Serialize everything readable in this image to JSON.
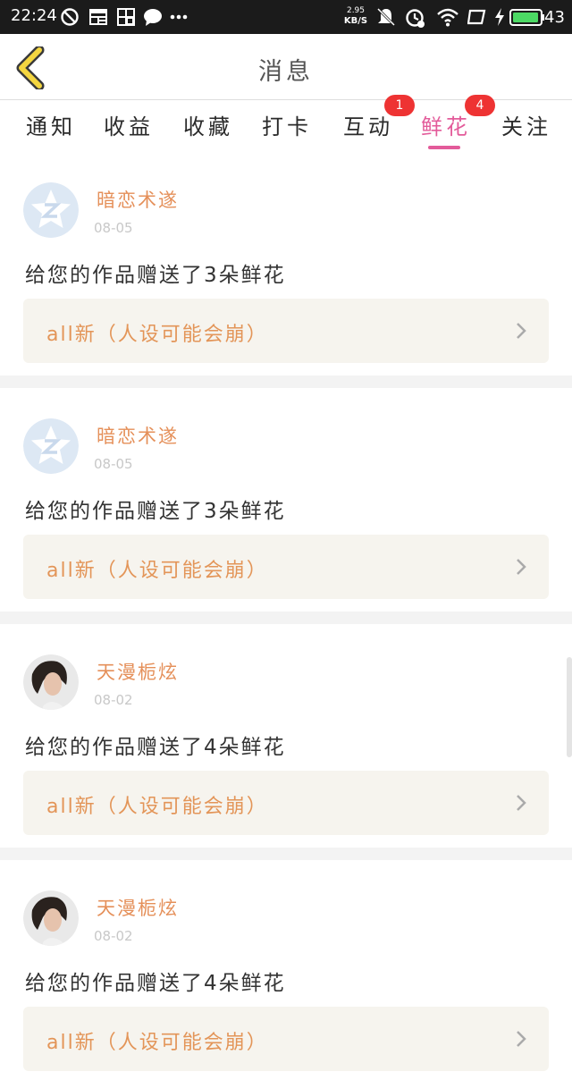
{
  "status_bar": {
    "time": "22:24",
    "net_speed_value": "2.95",
    "net_speed_unit": "KB/S",
    "battery": "43",
    "icons": [
      "do-not-disturb-icon",
      "news-icon",
      "qr-icon",
      "chat-icon",
      "more-icon",
      "mute-icon",
      "alarm-icon",
      "wifi-icon",
      "screen-icon",
      "charging-icon",
      "battery-icon"
    ]
  },
  "header": {
    "title": "消息",
    "back_icon": "back-arrow-icon"
  },
  "tabs": [
    {
      "label": "通知"
    },
    {
      "label": "收益"
    },
    {
      "label": "收藏"
    },
    {
      "label": "打卡"
    },
    {
      "label": "互动",
      "badge": "1"
    },
    {
      "label": "鲜花",
      "badge": "4",
      "active": true
    },
    {
      "label": "关注"
    }
  ],
  "colors": {
    "accent": "#e35b9a",
    "username": "#e5905a",
    "badge": "#ee3333",
    "link_bg": "#f6f4ee"
  },
  "messages": [
    {
      "username": "暗恋术遂",
      "date": "08-05",
      "text": "给您的作品赠送了3朵鲜花",
      "work_title": "all新（人设可能会崩）",
      "avatar": "qq-default-avatar"
    },
    {
      "username": "暗恋术遂",
      "date": "08-05",
      "text": "给您的作品赠送了3朵鲜花",
      "work_title": "all新（人设可能会崩）",
      "avatar": "qq-default-avatar"
    },
    {
      "username": "天漫栀炫",
      "date": "08-02",
      "text": "给您的作品赠送了4朵鲜花",
      "work_title": "all新（人设可能会崩）",
      "avatar": "portrait-avatar"
    },
    {
      "username": "天漫栀炫",
      "date": "08-02",
      "text": "给您的作品赠送了4朵鲜花",
      "work_title": "all新（人设可能会崩）",
      "avatar": "portrait-avatar"
    }
  ]
}
